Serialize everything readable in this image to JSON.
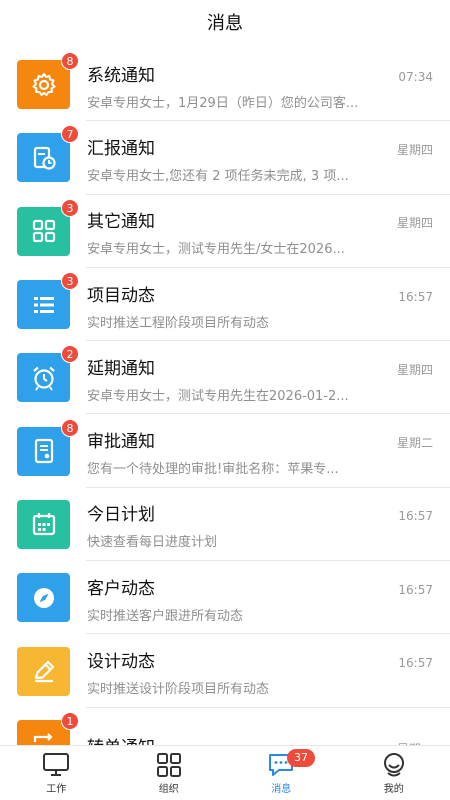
{
  "header": {
    "title": "消息"
  },
  "messages": [
    {
      "title": "系统通知",
      "subtitle": "安卓专用女士，1月29日（昨日）您的公司客...",
      "time": "07:34",
      "badge": "8",
      "color": "#f5870f",
      "icon": "gear-icon"
    },
    {
      "title": "汇报通知",
      "subtitle": "安卓专用女士,您还有 2 项任务未完成, 3 项...",
      "time": "星期四",
      "badge": "7",
      "color": "#2fa0ea",
      "icon": "report-clock-icon"
    },
    {
      "title": "其它通知",
      "subtitle": "安卓专用女士，测试专用先生/女士在2026...",
      "time": "星期四",
      "badge": "3",
      "color": "#27c0a1",
      "icon": "grid-icon"
    },
    {
      "title": "项目动态",
      "subtitle": "实时推送工程阶段项目所有动态",
      "time": "16:57",
      "badge": "3",
      "color": "#2fa0ea",
      "icon": "list-icon"
    },
    {
      "title": "延期通知",
      "subtitle": "安卓专用女士，测试专用先生在2026-01-2...",
      "time": "星期四",
      "badge": "2",
      "color": "#2fa0ea",
      "icon": "alarm-clock-icon"
    },
    {
      "title": "审批通知",
      "subtitle": "您有一个待处理的审批!审批名称：苹果专...",
      "time": "星期二",
      "badge": "8",
      "color": "#2fa0ea",
      "icon": "approval-document-icon"
    },
    {
      "title": "今日计划",
      "subtitle": "快速查看每日进度计划",
      "time": "16:57",
      "badge": "",
      "color": "#27c0a1",
      "icon": "calendar-icon"
    },
    {
      "title": "客户动态",
      "subtitle": "实时推送客户跟进所有动态",
      "time": "16:57",
      "badge": "",
      "color": "#2fa0ea",
      "icon": "compass-icon"
    },
    {
      "title": "设计动态",
      "subtitle": "实时推送设计阶段项目所有动态",
      "time": "16:57",
      "badge": "",
      "color": "#f7b733",
      "icon": "pencil-icon"
    },
    {
      "title": "转单通知",
      "subtitle": "",
      "time": "星期一",
      "badge": "1",
      "color": "#f5870f",
      "icon": "transfer-icon"
    }
  ],
  "tabbar": {
    "items": [
      {
        "label": "工作",
        "icon": "monitor-icon"
      },
      {
        "label": "组织",
        "icon": "grid-icon"
      },
      {
        "label": "消息",
        "icon": "chat-icon",
        "badge": "37",
        "active": true
      },
      {
        "label": "我的",
        "icon": "user-icon"
      }
    ],
    "active_color": "#2b88e6",
    "badge_color": "#f04a3b"
  }
}
